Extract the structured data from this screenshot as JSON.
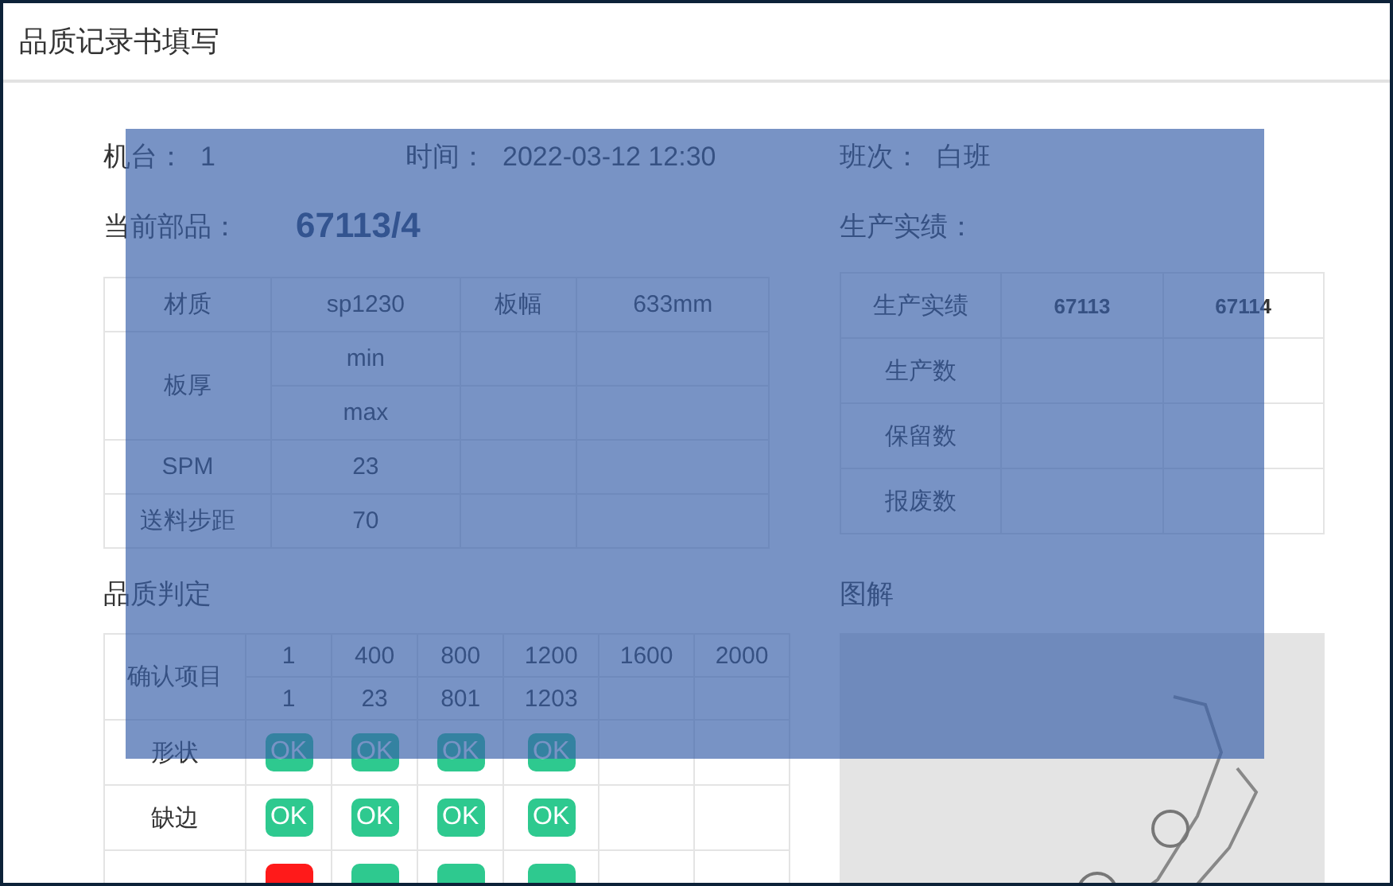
{
  "window": {
    "title": "品质记录书填写"
  },
  "info": [
    {
      "label": "机台：",
      "value": "1"
    },
    {
      "label": "时间：",
      "value": "2022-03-12 12:30"
    },
    {
      "label": "班次：",
      "value": "白班"
    }
  ],
  "current_part": {
    "label": "当前部品：",
    "value": "67113/4"
  },
  "spec_table": [
    {
      "label": "材质",
      "cells": [
        "sp1230",
        "板幅",
        "633mm"
      ]
    },
    {
      "label": "板厚",
      "subrows": [
        {
          "cells": [
            "min"
          ]
        },
        {
          "cells": [
            "max"
          ]
        }
      ]
    },
    {
      "label": "SPM",
      "cells": [
        "23"
      ]
    },
    {
      "label": "送料步距",
      "cells": [
        "70"
      ]
    }
  ],
  "production": {
    "title": "生产实绩：",
    "header": [
      "生产实绩",
      "67113",
      "67114"
    ],
    "rows": [
      "生产数",
      "保留数",
      "报废数"
    ]
  },
  "quality": {
    "title": "品质判定",
    "header_label": "确认项目",
    "planned": [
      "1",
      "400",
      "800",
      "1200",
      "1600",
      "2000"
    ],
    "actual": [
      "1",
      "23",
      "801",
      "1203"
    ],
    "rows": [
      {
        "label": "形状",
        "results": [
          {
            "passed": true,
            "label": "OK"
          },
          {
            "passed": true,
            "label": "OK"
          },
          {
            "passed": true,
            "label": "OK"
          },
          {
            "passed": true,
            "label": "OK"
          }
        ]
      },
      {
        "label": "缺边",
        "results": [
          {
            "passed": true,
            "label": "OK"
          },
          {
            "passed": true,
            "label": "OK"
          },
          {
            "passed": true,
            "label": "OK"
          },
          {
            "passed": true,
            "label": "OK"
          }
        ]
      },
      {
        "results": [
          {
            "passed": false
          },
          {
            "passed": true
          },
          {
            "passed": true
          },
          {
            "passed": true
          }
        ]
      }
    ]
  },
  "diagram": {
    "title": "图解"
  }
}
